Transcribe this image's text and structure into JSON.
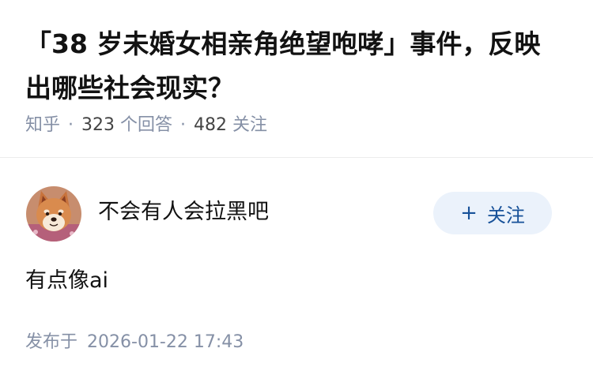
{
  "question": {
    "title": "「38 岁未婚女相亲角绝望咆哮」事件，反映出哪些社会现实？",
    "source": "知乎",
    "separator": "·",
    "answer_count": "323",
    "answer_label": "个回答",
    "follower_count": "482",
    "follower_label": "关注"
  },
  "answer": {
    "author_name": "不会有人会拉黑吧",
    "follow_icon": "plus-icon",
    "follow_symbol": "+",
    "follow_label": "关注",
    "content": "有点像ai",
    "published_label": "发布于",
    "published_time": "2026-01-22 17:43"
  },
  "colors": {
    "title": "#121212",
    "meta": "#8590a6",
    "follow_bg": "#ebf2fb",
    "follow_text": "#175199"
  }
}
